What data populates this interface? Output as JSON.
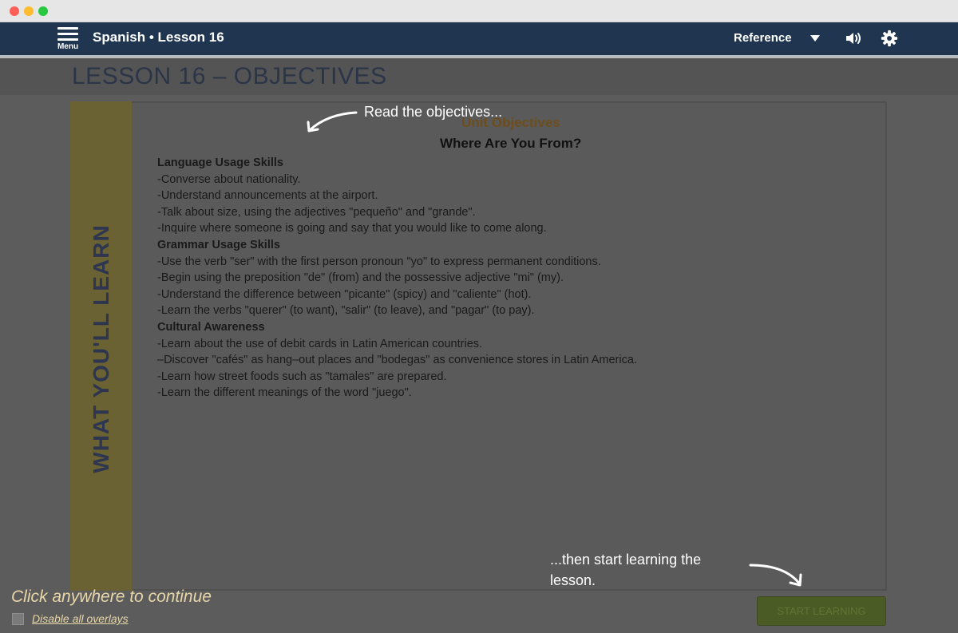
{
  "window": {
    "controls": [
      "close",
      "minimize",
      "maximize"
    ]
  },
  "header": {
    "menu_label": "Menu",
    "menu_icon": "hamburger-icon",
    "title": "Spanish • Lesson 16",
    "reference_label": "Reference",
    "reference_icon": "caret-down-icon",
    "sound_icon": "speaker-icon",
    "settings_icon": "gear-icon"
  },
  "page": {
    "title": "LESSON 16 – OBJECTIVES"
  },
  "side_tab": {
    "label": "WHAT YOU'LL LEARN"
  },
  "content": {
    "unit_objectives": "Unit Objectives",
    "unit_title": "Where Are You From?",
    "sections": [
      {
        "heading": "Language Usage Skills",
        "items": [
          "-Converse about nationality.",
          "-Understand announcements at the airport.",
          "-Talk about size, using the adjectives \"pequeño\" and \"grande\".",
          "-Inquire where someone is going and say that you would like to come along."
        ]
      },
      {
        "heading": "Grammar Usage Skills",
        "items": [
          "-Use the verb \"ser\" with the first person pronoun \"yo\" to express permanent conditions.",
          "-Begin using the preposition \"de\" (from) and the possessive adjective \"mi\" (my).",
          "-Understand the difference between \"picante\" (spicy) and \"caliente\" (hot).",
          "-Learn the verbs \"querer\" (to want), \"salir\" (to leave), and \"pagar\" (to pay)."
        ]
      },
      {
        "heading": "Cultural Awareness",
        "items": [
          "-Learn about the use of debit cards in Latin American countries.",
          "–Discover \"cafés\" as hang–out places and \"bodegas\" as convenience stores in Latin America.",
          "-Learn how street foods such as \"tamales\" are prepared.",
          "-Learn the different meanings of the word \"juego\"."
        ]
      }
    ]
  },
  "overlay": {
    "tip_read": "Read the objectives...",
    "tip_start": "...then start learning the lesson.",
    "click_continue": "Click anywhere to continue",
    "disable_overlays": "Disable all overlays",
    "disable_overlays_checked": false
  },
  "actions": {
    "start_learning": "START LEARNING"
  },
  "colors": {
    "header_bg": "#1f3550",
    "side_tab_bg": "#6b6234",
    "overlay_text": "#e7d6a8",
    "start_button_bg": "#4a5b26"
  }
}
